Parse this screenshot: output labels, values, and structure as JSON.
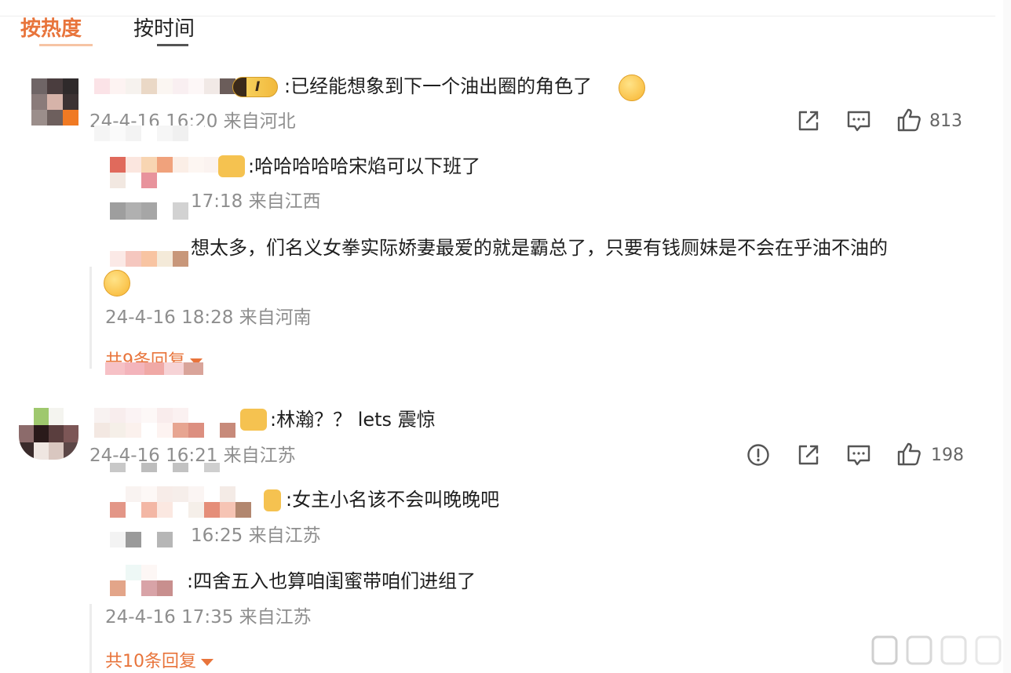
{
  "tabs": {
    "hot_label": "按热度",
    "time_label": "按时间"
  },
  "comments": [
    {
      "text": ":已经能想象到下一个油出圈的角色了",
      "meta": "24-4-16 16:20 来自河北",
      "likes": "813",
      "replies": [
        {
          "text": ":哈哈哈哈哈宋焰可以下班了",
          "meta": "17:18 来自江西"
        },
        {
          "text": "想太多，们名义女拳实际娇妻最爱的就是霸总了，只要有钱厕妹是不会在乎油不油的",
          "meta": "24-4-16 18:28 来自河南"
        }
      ],
      "reply_count_label": "共9条回复"
    },
    {
      "text": ":林瀚？？ lets 震惊",
      "meta": "24-4-16 16:21 来自江苏",
      "likes": "198",
      "replies": [
        {
          "text": ":女主小名该不会叫晚晚吧",
          "meta": "16:25 来自江苏"
        },
        {
          "text": ":四舍五入也算咱闺蜜带咱们进组了",
          "meta": "24-4-16 17:35 来自江苏"
        }
      ],
      "reply_count_label": "共10条回复"
    }
  ],
  "badge_text": "I",
  "icons": [
    "share-icon",
    "comment-icon",
    "like-icon",
    "report-icon"
  ],
  "colors": {
    "accent": "#e8743b",
    "meta": "#8e8e8e"
  }
}
